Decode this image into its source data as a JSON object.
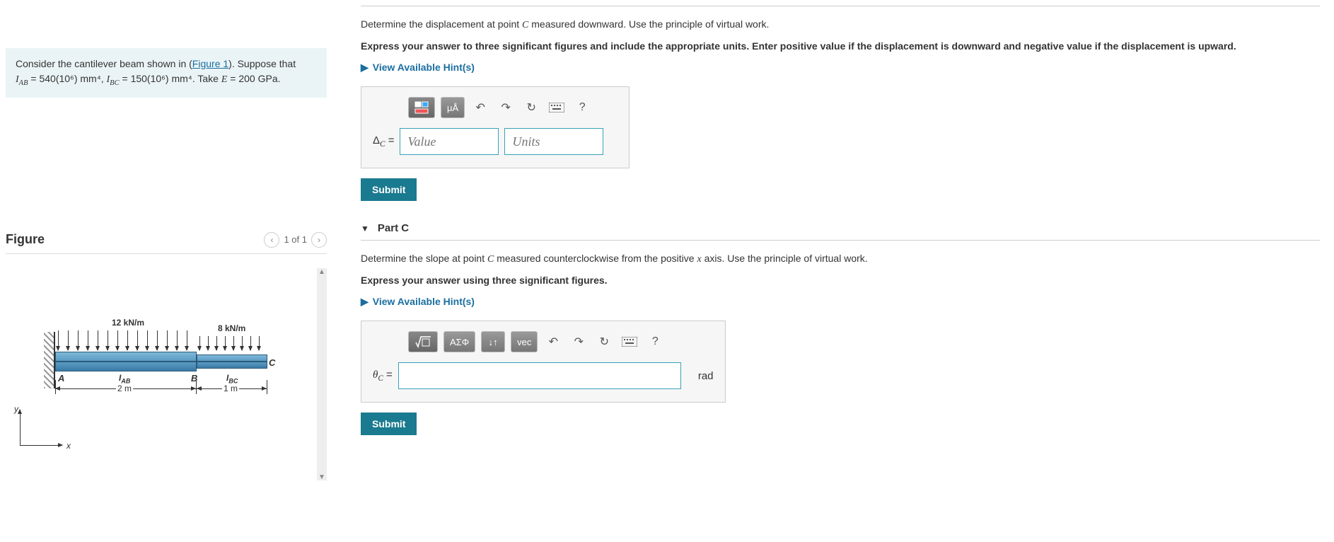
{
  "problem": {
    "intro_prefix": "Consider the cantilever beam shown in (",
    "figure_link": "Figure 1",
    "intro_suffix": "). Suppose that ",
    "iab_html": "I<sub>AB</sub> = 540(10<sup>6</sup>) mm<sup>4</sup>",
    "ibc_html": ", I<sub>BC</sub> = 150(10<sup>6</sup>) mm<sup>4</sup>. Take E = 200 GPa.",
    "iab_val": "540(10⁶) mm⁴",
    "ibc_val": "150(10⁶) mm⁴",
    "e_val": "200 GPa"
  },
  "figure": {
    "title": "Figure",
    "pager": "1 of 1",
    "load_ab": "12 kN/m",
    "load_bc": "8 kN/m",
    "pt_a": "A",
    "pt_b": "B",
    "pt_c": "C",
    "i_ab": "I",
    "i_ab_sub": "AB",
    "i_bc": "I",
    "i_bc_sub": "BC",
    "len_ab": "2 m",
    "len_bc": "1 m",
    "axis_x": "x",
    "axis_y": "y"
  },
  "partB": {
    "question_prefix": "Determine the displacement at point ",
    "point": "C",
    "question_suffix": " measured downward. Use the principle of virtual work.",
    "instruction": "Express your answer to three significant figures and include the appropriate units. Enter positive value if the displacement is downward and negative value if the displacement is upward.",
    "hint": "View Available Hint(s)",
    "var_label": "Δ",
    "var_sub": "C",
    "equals": " =",
    "value_ph": "Value",
    "units_ph": "Units",
    "submit": "Submit",
    "tool_units": "μÅ",
    "tool_help": "?"
  },
  "partC": {
    "title": "Part C",
    "question_prefix": "Determine the slope at point ",
    "point": "C",
    "question_mid": " measured counterclockwise from the positive ",
    "axis": "x",
    "question_suffix": " axis. Use the principle of virtual work.",
    "instruction": "Express your answer using three significant figures.",
    "hint": "View Available Hint(s)",
    "var_label": "θ",
    "var_sub": "C",
    "equals": " =",
    "unit": "rad",
    "submit": "Submit",
    "tool_sigma": "ΑΣΦ",
    "tool_updown": "↓↑",
    "tool_vec": "vec",
    "tool_help": "?"
  }
}
